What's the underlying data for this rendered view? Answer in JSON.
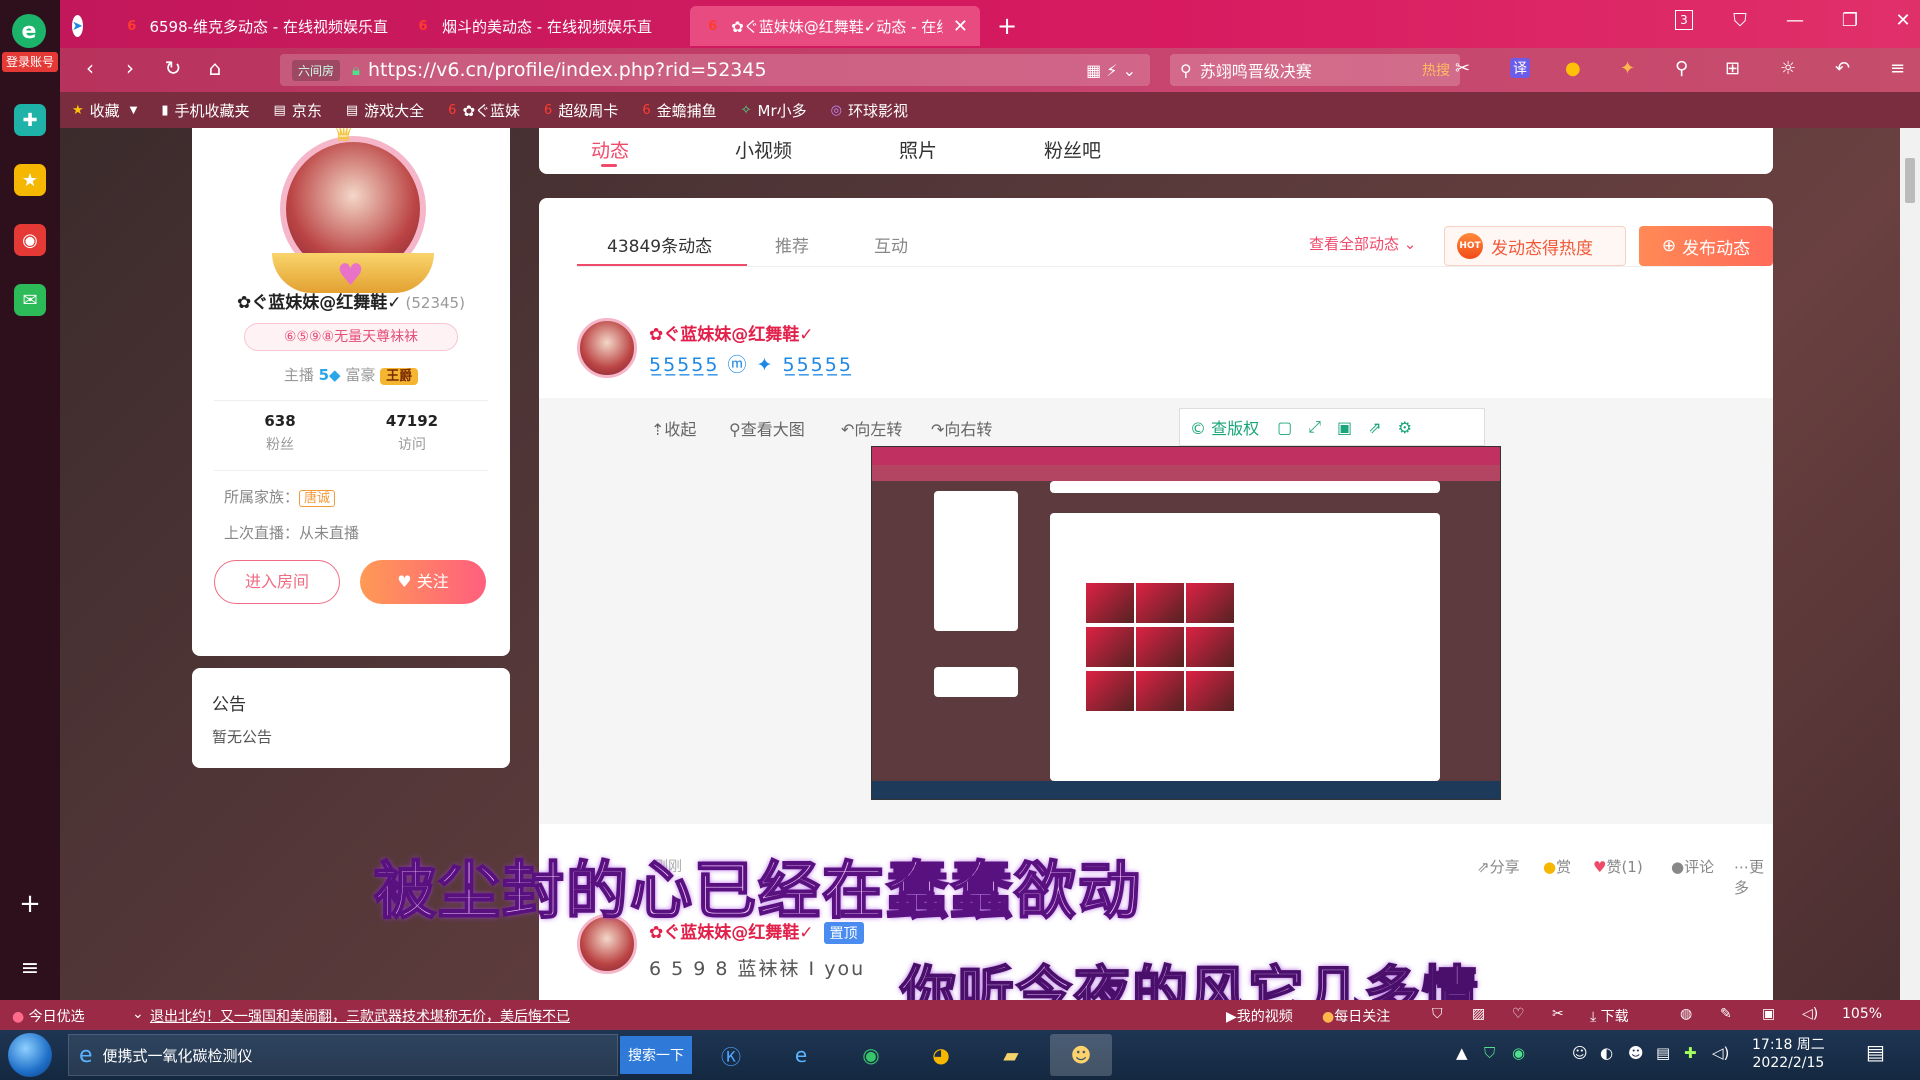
{
  "browser": {
    "tabs": [
      {
        "label": "6598-维克多动态 - 在线视频娱乐直",
        "active": false
      },
      {
        "label": "烟斗的美动态 - 在线视频娱乐直",
        "active": false
      },
      {
        "label": "✿ぐ蓝妹妹@红舞鞋✓动态 - 在线",
        "active": true
      }
    ],
    "tab_count": "3",
    "new_tab": "+",
    "login_label": "登录账号",
    "url_badge": "六间房",
    "url": "https://v6.cn/profile/index.php?rid=52345",
    "search_text": "苏翊鸣晋级决赛",
    "search_hot": "热搜",
    "translate_label": "译",
    "bookmarks": [
      "收藏",
      "手机收藏夹",
      "京东",
      "游戏大全",
      "✿ぐ蓝妹",
      "超级周卡",
      "金蟾捕鱼",
      "Mr小多",
      "环球影视"
    ]
  },
  "profile": {
    "name": "✿ぐ蓝妹妹@红舞鞋✓",
    "rid": "(52345)",
    "title_badge": "⑥⑤⑨⑧无量天尊袜袜",
    "anchor_label": "主播",
    "anchor_level": "5",
    "rich_label": "富豪",
    "rich_badge": "王爵",
    "fans_count": "638",
    "fans_label": "粉丝",
    "visits_count": "47192",
    "visits_label": "访问",
    "family_label": "所属家族：",
    "family_tag": "唐诚",
    "last_live": "上次直播：从未直播",
    "enter_room": "进入房间",
    "follow": "关注"
  },
  "notice": {
    "title": "公告",
    "content": "暂无公告"
  },
  "page_tabs": [
    {
      "label": "动态",
      "active": true
    },
    {
      "label": "小视频",
      "active": false
    },
    {
      "label": "照片",
      "active": false
    },
    {
      "label": "粉丝吧",
      "active": false
    }
  ],
  "feed": {
    "tabs": [
      {
        "label": "43849条动态",
        "active": true
      },
      {
        "label": "推荐",
        "active": false
      },
      {
        "label": "互动",
        "active": false
      }
    ],
    "view_all": "查看全部动态",
    "hot_button": "发动态得热度",
    "hot_icon_text": "HOT",
    "post_button": "发布动态",
    "post1": {
      "author": "✿ぐ蓝妹妹@红舞鞋✓",
      "badges": "5̲5̲5̲5̲5̲ ⓜ ✦ 5̲5̲5̲5̲5̲",
      "tools": [
        "收起",
        "查看大图",
        "向左转",
        "向右转"
      ],
      "viewer_title": "查版权",
      "time": "刚刚",
      "actions": [
        "分享",
        "赏",
        "赞(1)",
        "评论",
        "更多"
      ]
    },
    "post2": {
      "author": "✿ぐ蓝妹妹@红舞鞋✓",
      "top_badge": "置顶",
      "badges": "6 5 9 8 蓝袜袜 I you"
    }
  },
  "lyrics": {
    "line1": "被尘封的心已经在蠢蠢欲动",
    "line2": "你听今夜的风它几多情"
  },
  "statusbar": {
    "today": "今日优选",
    "news": "退出北约！又一强国和美闹翻，三款武器技术堪称无价，美后悔不已",
    "my_video": "我的视频",
    "daily_follow": "每日关注",
    "download": "下载",
    "zoom": "105%"
  },
  "taskbar": {
    "task_title": "便携式一氧化碳检测仪",
    "search_button": "搜索一下",
    "time": "17:18 周二",
    "date": "2022/2/15"
  }
}
